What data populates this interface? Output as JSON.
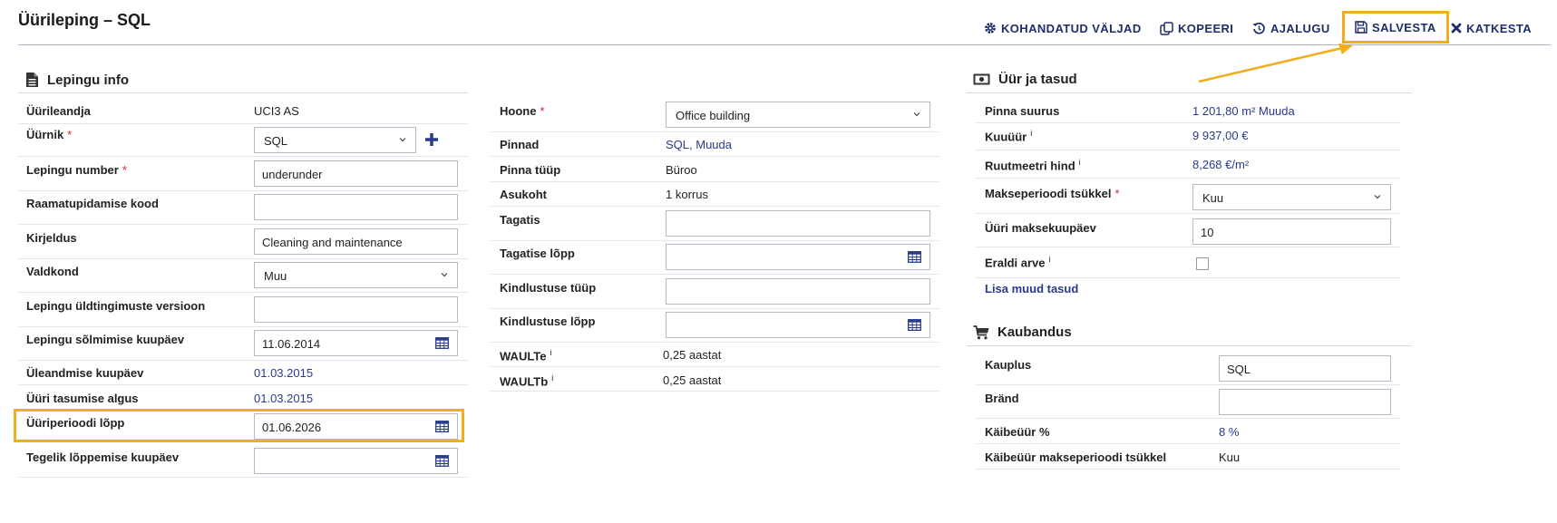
{
  "header": {
    "title": "Üürileping – SQL",
    "actions": {
      "custom_fields": "KOHANDATUD VÄLJAD",
      "copy": "KOPEERI",
      "history": "AJALUGU",
      "save": "SALVESTA",
      "cancel": "KATKESTA"
    }
  },
  "contract_info": {
    "title": "Lepingu info",
    "rows": {
      "landlord": {
        "label": "Üürileandja",
        "value": "UCI3 AS"
      },
      "tenant": {
        "label": "Üürnik",
        "value": "SQL"
      },
      "contract_number": {
        "label": "Lepingu number",
        "value": "underunder"
      },
      "accounting_code": {
        "label": "Raamatupidamise kood",
        "value": ""
      },
      "description": {
        "label": "Kirjeldus",
        "value": "Cleaning and maintenance"
      },
      "domain": {
        "label": "Valdkond",
        "value": "Muu"
      },
      "general_terms_version": {
        "label": "Lepingu üldtingimuste versioon",
        "value": ""
      },
      "signing_date": {
        "label": "Lepingu sõlmimise kuupäev",
        "value": "11.06.2014"
      },
      "handover_date": {
        "label": "Üleandmise kuupäev",
        "value": "01.03.2015"
      },
      "rent_payment_start": {
        "label": "Üüri tasumise algus",
        "value": "01.03.2015"
      },
      "lease_period_end": {
        "label": "Üüriperioodi lõpp",
        "value": "01.06.2026"
      },
      "actual_end_date": {
        "label": "Tegelik lõppemise kuupäev",
        "value": ""
      }
    }
  },
  "property": {
    "rows": {
      "building": {
        "label": "Hoone",
        "value": "Office building"
      },
      "premises": {
        "label": "Pinnad",
        "value": "SQL, Muuda"
      },
      "premises_type": {
        "label": "Pinna tüüp",
        "value": "Büroo"
      },
      "location": {
        "label": "Asukoht",
        "value": "1 korrus"
      },
      "deposit": {
        "label": "Tagatis",
        "value": ""
      },
      "deposit_end": {
        "label": "Tagatise lõpp",
        "value": ""
      },
      "insurance_type": {
        "label": "Kindlustuse tüüp",
        "value": ""
      },
      "insurance_end": {
        "label": "Kindlustuse lõpp",
        "value": ""
      },
      "wault_e": {
        "label": "WAULTe",
        "info": "i",
        "value": "0,25 aastat"
      },
      "wault_b": {
        "label": "WAULTb",
        "info": "i",
        "value": "0,25 aastat"
      }
    }
  },
  "rent_fees": {
    "title": "Üür ja tasud",
    "rows": {
      "area": {
        "label": "Pinna suurus",
        "value": "1 201,80 m² Muuda"
      },
      "monthly_rent": {
        "label": "Kuuüür",
        "info": "i",
        "value": "9 937,00 €"
      },
      "sqm_price": {
        "label": "Ruutmeetri hind",
        "info": "i",
        "value": "8,268 €/m²"
      },
      "payment_cycle": {
        "label": "Makseperioodi tsükkel",
        "value": "Kuu"
      },
      "payment_day": {
        "label": "Üüri maksekuupäev",
        "value": "10"
      },
      "separate_invoice": {
        "label": "Eraldi arve",
        "info": "i"
      }
    },
    "add_fees_link": "Lisa muud tasud"
  },
  "commerce": {
    "title": "Kaubandus",
    "rows": {
      "shop": {
        "label": "Kauplus",
        "value": "SQL"
      },
      "brand": {
        "label": "Bränd",
        "value": ""
      },
      "turnover_rent": {
        "label": "Käibeüür %",
        "value": "8 %"
      },
      "turnover_cycle": {
        "label": "Käibeüür makseperioodi tsükkel",
        "value": "Kuu"
      }
    }
  },
  "colors": {
    "accent": "#1f2d6b",
    "highlight": "#f0ad1d",
    "required": "#d9262e",
    "link": "#283a8e"
  }
}
